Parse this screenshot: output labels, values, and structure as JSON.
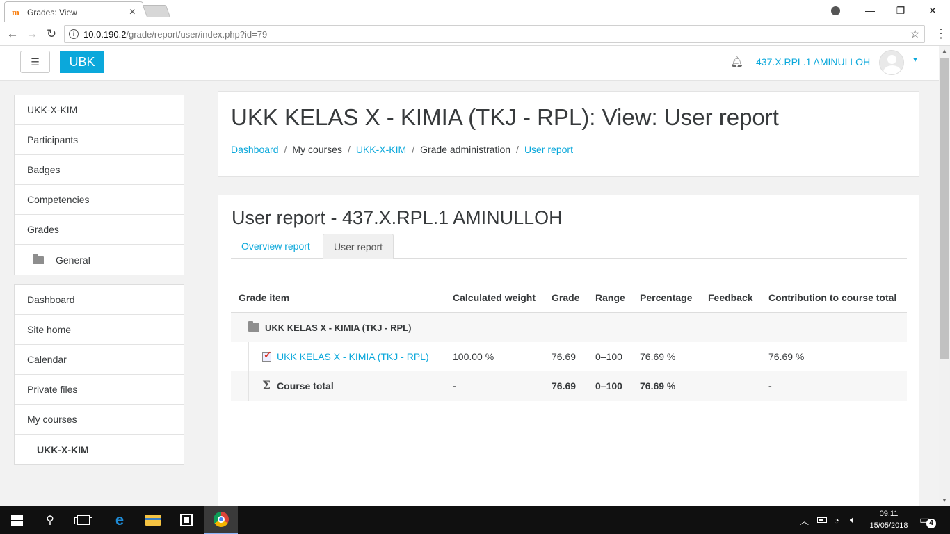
{
  "browser": {
    "tab_title": "Grades: View",
    "tab_favicon": "m",
    "url_host": "10.0.190.2",
    "url_path": "/grade/report/user/index.php?id=79"
  },
  "navbar": {
    "brand": "UBK",
    "user_name": "437.X.RPL.1 AMINULLOH"
  },
  "sidebar": {
    "course_block": [
      {
        "label": "UKK-X-KIM"
      },
      {
        "label": "Participants"
      },
      {
        "label": "Badges"
      },
      {
        "label": "Competencies"
      },
      {
        "label": "Grades"
      },
      {
        "label": "General"
      }
    ],
    "site_block": [
      {
        "label": "Dashboard"
      },
      {
        "label": "Site home"
      },
      {
        "label": "Calendar"
      },
      {
        "label": "Private files"
      },
      {
        "label": "My courses"
      },
      {
        "label": "UKK-X-KIM"
      }
    ]
  },
  "header": {
    "title": "UKK KELAS X - KIMIA (TKJ - RPL): View: User report",
    "breadcrumb": [
      {
        "label": "Dashboard"
      },
      {
        "label": "My courses"
      },
      {
        "label": "UKK-X-KIM"
      },
      {
        "label": "Grade administration"
      },
      {
        "label": "User report"
      }
    ],
    "separator": "/"
  },
  "report": {
    "title": "User report - 437.X.RPL.1 AMINULLOH",
    "tabs": [
      {
        "label": "Overview report"
      },
      {
        "label": "User report"
      }
    ],
    "columns": [
      "Grade item",
      "Calculated weight",
      "Grade",
      "Range",
      "Percentage",
      "Feedback",
      "Contribution to course total"
    ],
    "category_row": {
      "item": "UKK KELAS X - KIMIA (TKJ - RPL)"
    },
    "item_row": {
      "item": "UKK KELAS X - KIMIA (TKJ - RPL)",
      "weight": "100.00 %",
      "grade": "76.69",
      "range": "0–100",
      "percentage": "76.69 %",
      "feedback": "",
      "contribution": "76.69 %"
    },
    "total_row": {
      "item": "Course total",
      "weight": "-",
      "grade": "76.69",
      "range": "0–100",
      "percentage": "76.69 %",
      "feedback": "",
      "contribution": "-"
    }
  },
  "taskbar": {
    "time": "09.11",
    "date": "15/05/2018",
    "notification_count": "4"
  }
}
